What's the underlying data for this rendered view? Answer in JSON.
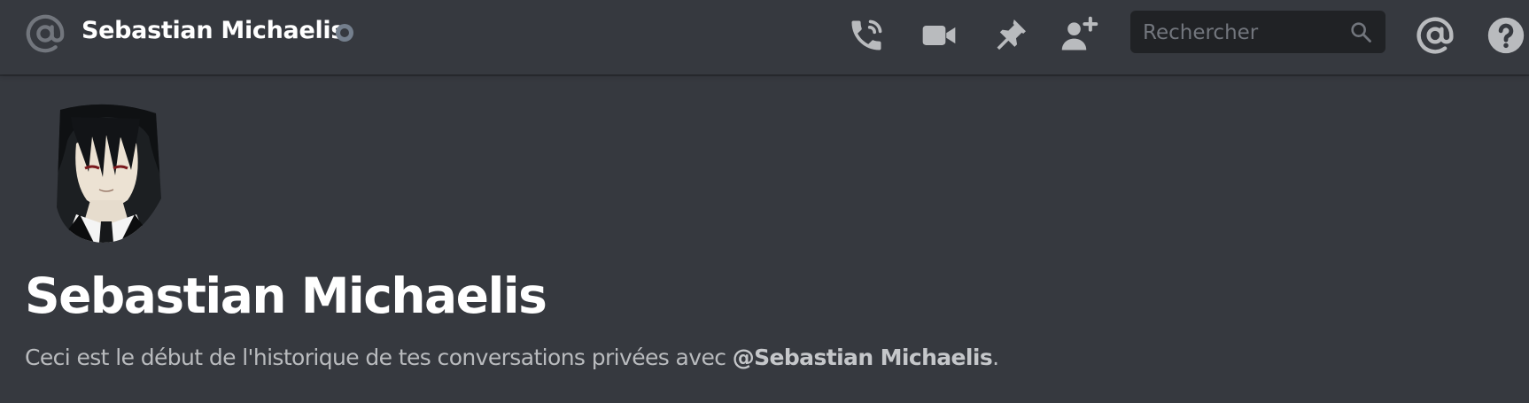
{
  "header": {
    "channel_name": "Sebastian Michaelis",
    "status": "offline",
    "icons": {
      "left": "at-sign-icon",
      "call": "phone-call-icon",
      "video": "video-camera-icon",
      "pin": "pin-icon",
      "add_friend": "add-user-icon",
      "search": "search-icon",
      "mentions": "at-sign-icon",
      "help": "help-icon"
    },
    "search_placeholder": "Rechercher"
  },
  "profile": {
    "display_name": "Sebastian Michaelis",
    "intro_prefix": "Ceci est le début de l'historique de tes conversations privées avec ",
    "mention": "@Sebastian Michaelis",
    "intro_suffix": "."
  },
  "colors": {
    "background": "#36393f",
    "search_bg": "#202225",
    "icon": "#b9bbbe",
    "status_offline": "#747f8d",
    "text_primary": "#ffffff",
    "text_muted": "#b9bbbe"
  }
}
